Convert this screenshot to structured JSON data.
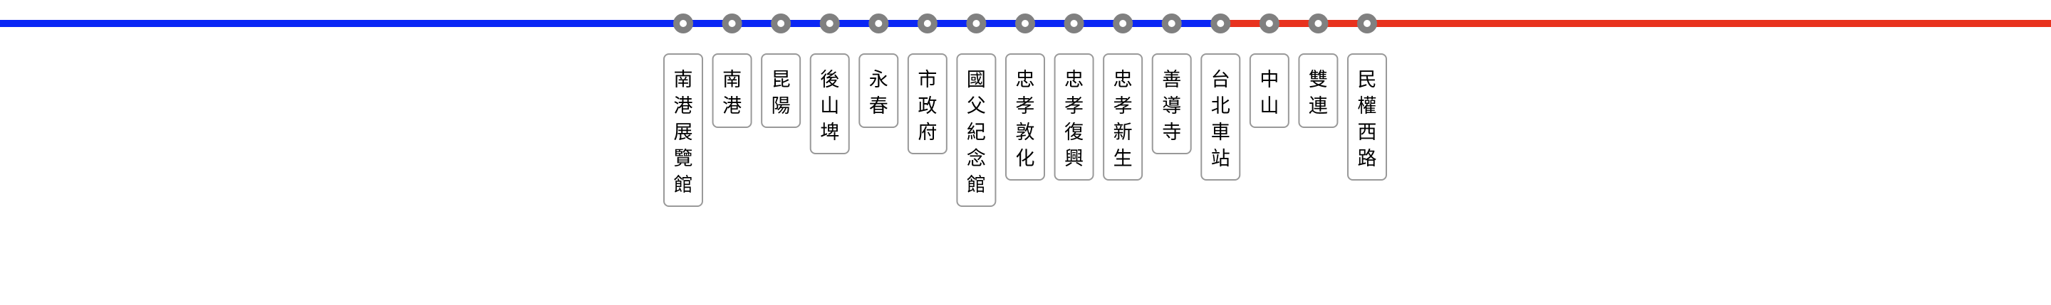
{
  "line": {
    "segments": [
      {
        "name": "blue-line",
        "color": "#0a26f5",
        "from_station": 0,
        "to_station": 11,
        "extends_left": true
      },
      {
        "name": "red-line",
        "color": "#e8321e",
        "from_station": 11,
        "to_station": 14,
        "extends_right": true
      }
    ]
  },
  "colors": {
    "station_marker": "#808080",
    "label_border": "#999999",
    "label_fill": "#ffffff",
    "label_text": "#000000"
  },
  "stations": [
    {
      "name": "南港展覽館",
      "chars": [
        "南",
        "港",
        "展",
        "覽",
        "館"
      ]
    },
    {
      "name": "南港",
      "chars": [
        "南",
        "港"
      ]
    },
    {
      "name": "昆陽",
      "chars": [
        "昆",
        "陽"
      ]
    },
    {
      "name": "後山埤",
      "chars": [
        "後",
        "山",
        "埤"
      ]
    },
    {
      "name": "永春",
      "chars": [
        "永",
        "春"
      ]
    },
    {
      "name": "市政府",
      "chars": [
        "市",
        "政",
        "府"
      ]
    },
    {
      "name": "國父紀念館",
      "chars": [
        "國",
        "父",
        "紀",
        "念",
        "館"
      ]
    },
    {
      "name": "忠孝敦化",
      "chars": [
        "忠",
        "孝",
        "敦",
        "化"
      ]
    },
    {
      "name": "忠孝復興",
      "chars": [
        "忠",
        "孝",
        "復",
        "興"
      ]
    },
    {
      "name": "忠孝新生",
      "chars": [
        "忠",
        "孝",
        "新",
        "生"
      ]
    },
    {
      "name": "善導寺",
      "chars": [
        "善",
        "導",
        "寺"
      ]
    },
    {
      "name": "台北車站",
      "chars": [
        "台",
        "北",
        "車",
        "站"
      ]
    },
    {
      "name": "中山",
      "chars": [
        "中",
        "山"
      ]
    },
    {
      "name": "雙連",
      "chars": [
        "雙",
        "連"
      ]
    },
    {
      "name": "民權西路",
      "chars": [
        "民",
        "權",
        "西",
        "路"
      ]
    }
  ]
}
